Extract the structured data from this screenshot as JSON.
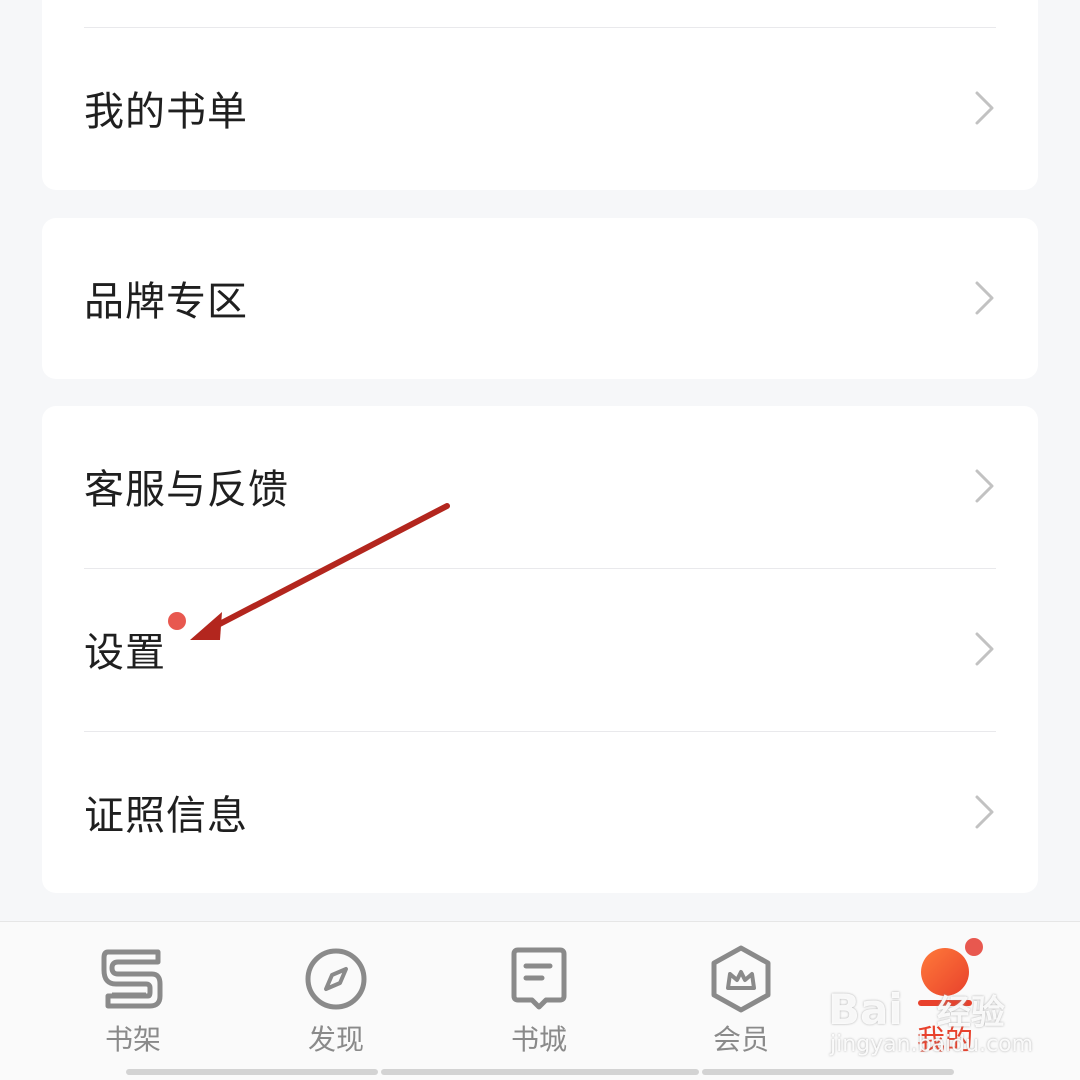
{
  "menu": {
    "items": [
      {
        "label": "我的书单"
      },
      {
        "label": "品牌专区"
      },
      {
        "label": "客服与反馈"
      },
      {
        "label": "设置"
      },
      {
        "label": "证照信息"
      }
    ]
  },
  "tabbar": {
    "tabs": [
      {
        "label": "书架",
        "icon": "bookshelf-icon"
      },
      {
        "label": "发现",
        "icon": "compass-icon"
      },
      {
        "label": "书城",
        "icon": "book-store-icon"
      },
      {
        "label": "会员",
        "icon": "crown-hexagon-icon"
      },
      {
        "label": "我的",
        "icon": "profile-icon"
      }
    ],
    "active_index": 4
  },
  "watermark": {
    "brand": "Bai",
    "brand_cn": "经验",
    "url": "jingyan.baidu.com"
  },
  "colors": {
    "accent": "#e8412c",
    "badge": "#e8584f",
    "annotation_arrow": "#b3261e",
    "inactive_icon": "#8a8a8a",
    "text": "#1f1f1f"
  }
}
